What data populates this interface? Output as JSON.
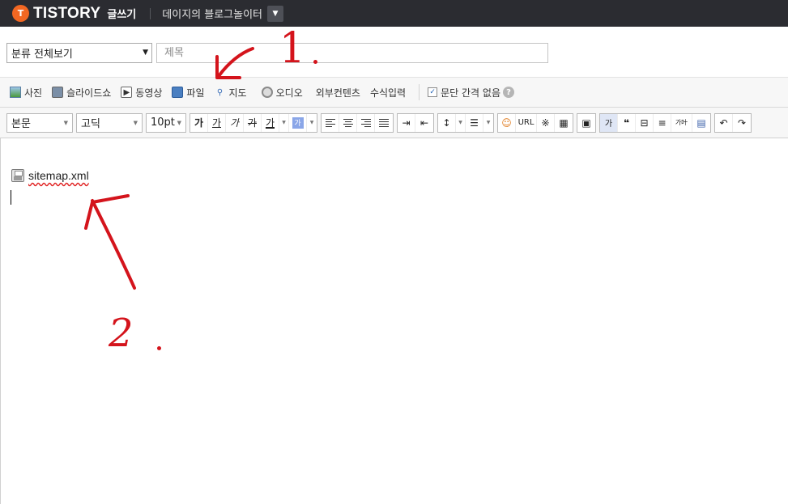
{
  "header": {
    "logo_mark": "T",
    "brand": "TISTORY",
    "section": "글쓰기",
    "blog_name": "데이지의 블로그놀이터",
    "blog_dropdown_icon": "chevron-down-icon"
  },
  "title_row": {
    "category_value": "분류 전체보기",
    "title_placeholder": "제목"
  },
  "attach_toolbar": {
    "items": [
      {
        "label": "사진",
        "icon": "photo-icon"
      },
      {
        "label": "슬라이드쇼",
        "icon": "slideshow-icon"
      },
      {
        "label": "동영상",
        "icon": "video-icon"
      },
      {
        "label": "파일",
        "icon": "file-icon"
      },
      {
        "label": "지도",
        "icon": "map-icon"
      },
      {
        "label": "오디오",
        "icon": "audio-icon"
      },
      {
        "label": "외부컨텐츠"
      },
      {
        "label": "수식입력"
      }
    ],
    "paragraph_spacing_label": "문단 간격 없음",
    "paragraph_spacing_checked": true
  },
  "format_toolbar": {
    "style_value": "본문",
    "font_value": "고딕",
    "size_value": "10pt",
    "bold": "가",
    "underline": "가",
    "italic": "가",
    "strike": "가",
    "font_color": "가",
    "highlight": "가",
    "url_label": "URL",
    "special_char": "※",
    "box_label": "가",
    "quote_label": "❝",
    "hanja_label": "가叶"
  },
  "editor": {
    "attachment_name": "sitemap.xml"
  },
  "annotations": {
    "top_label": "1",
    "bottom_label": "2",
    "color": "#d4141c"
  }
}
